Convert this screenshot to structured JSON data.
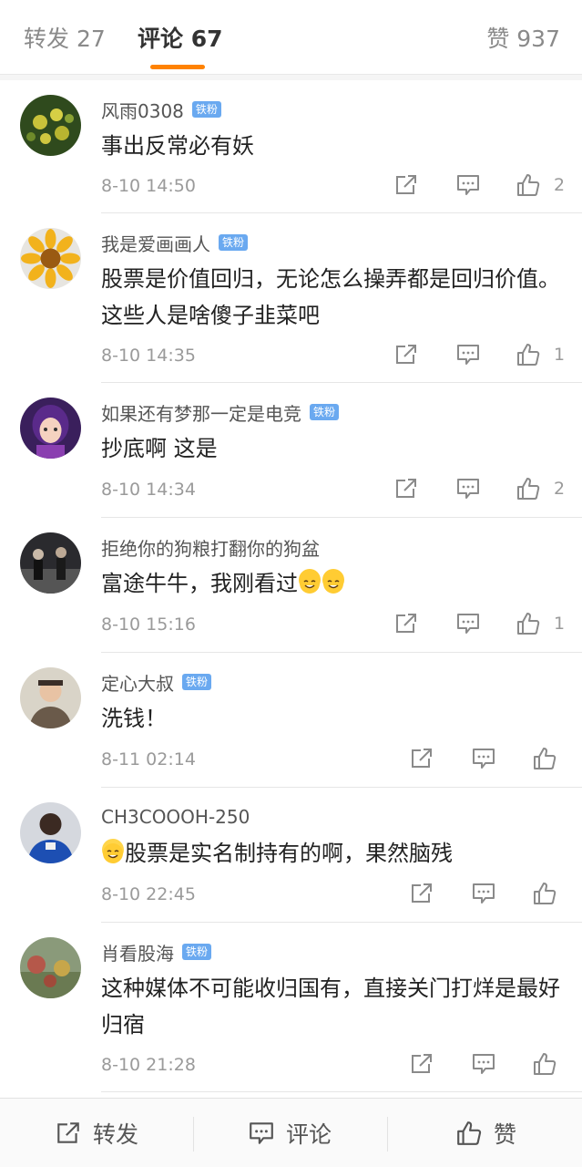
{
  "tabs": {
    "repost": "转发 27",
    "comment": "评论 67",
    "like": "赞 937"
  },
  "badge_label": "铁粉",
  "comments": [
    {
      "name": "风雨0308",
      "badge": true,
      "text": "事出反常必有妖",
      "time": "8-10 14:50",
      "likes": "2",
      "avatar_icon": "flower-photo"
    },
    {
      "name": "我是爱画画人",
      "badge": true,
      "text": "股票是价值回归，无论怎么操弄都是回归价值。这些人是啥傻子韭菜吧",
      "time": "8-10 14:35",
      "likes": "1",
      "avatar_icon": "sunflower-photo"
    },
    {
      "name": "如果还有梦那一定是电竞",
      "badge": true,
      "text": "抄底啊 这是",
      "time": "8-10 14:34",
      "likes": "2",
      "avatar_icon": "anime-girl-avatar"
    },
    {
      "name": "拒绝你的狗粮打翻你的狗盆",
      "badge": false,
      "text": "富途牛牛，我刚看过",
      "emoji_after": "laugh-cry",
      "time": "8-10 15:16",
      "likes": "1",
      "avatar_icon": "stage-performer-photo"
    },
    {
      "name": "定心大叔",
      "badge": true,
      "text": "洗钱！",
      "time": "8-11 02:14",
      "likes": "",
      "avatar_icon": "man-portrait-photo"
    },
    {
      "name": "CH3COOOH-250",
      "badge": false,
      "emoji_before": "sweat",
      "text": "股票是实名制持有的啊，果然脑残",
      "time": "8-10 22:45",
      "likes": "",
      "avatar_icon": "football-player-photo"
    },
    {
      "name": "肖看股海",
      "badge": true,
      "text": "这种媒体不可能收归国有，直接关门打烊是最好归宿",
      "time": "8-10 21:28",
      "likes": "",
      "avatar_icon": "garden-photo"
    }
  ],
  "bottom_bar": {
    "repost": "转发",
    "comment": "评论",
    "like": "赞"
  },
  "colors": {
    "accent": "#ff8200",
    "badge": "#6aa9f0",
    "muted_text": "#9a9a9a"
  }
}
